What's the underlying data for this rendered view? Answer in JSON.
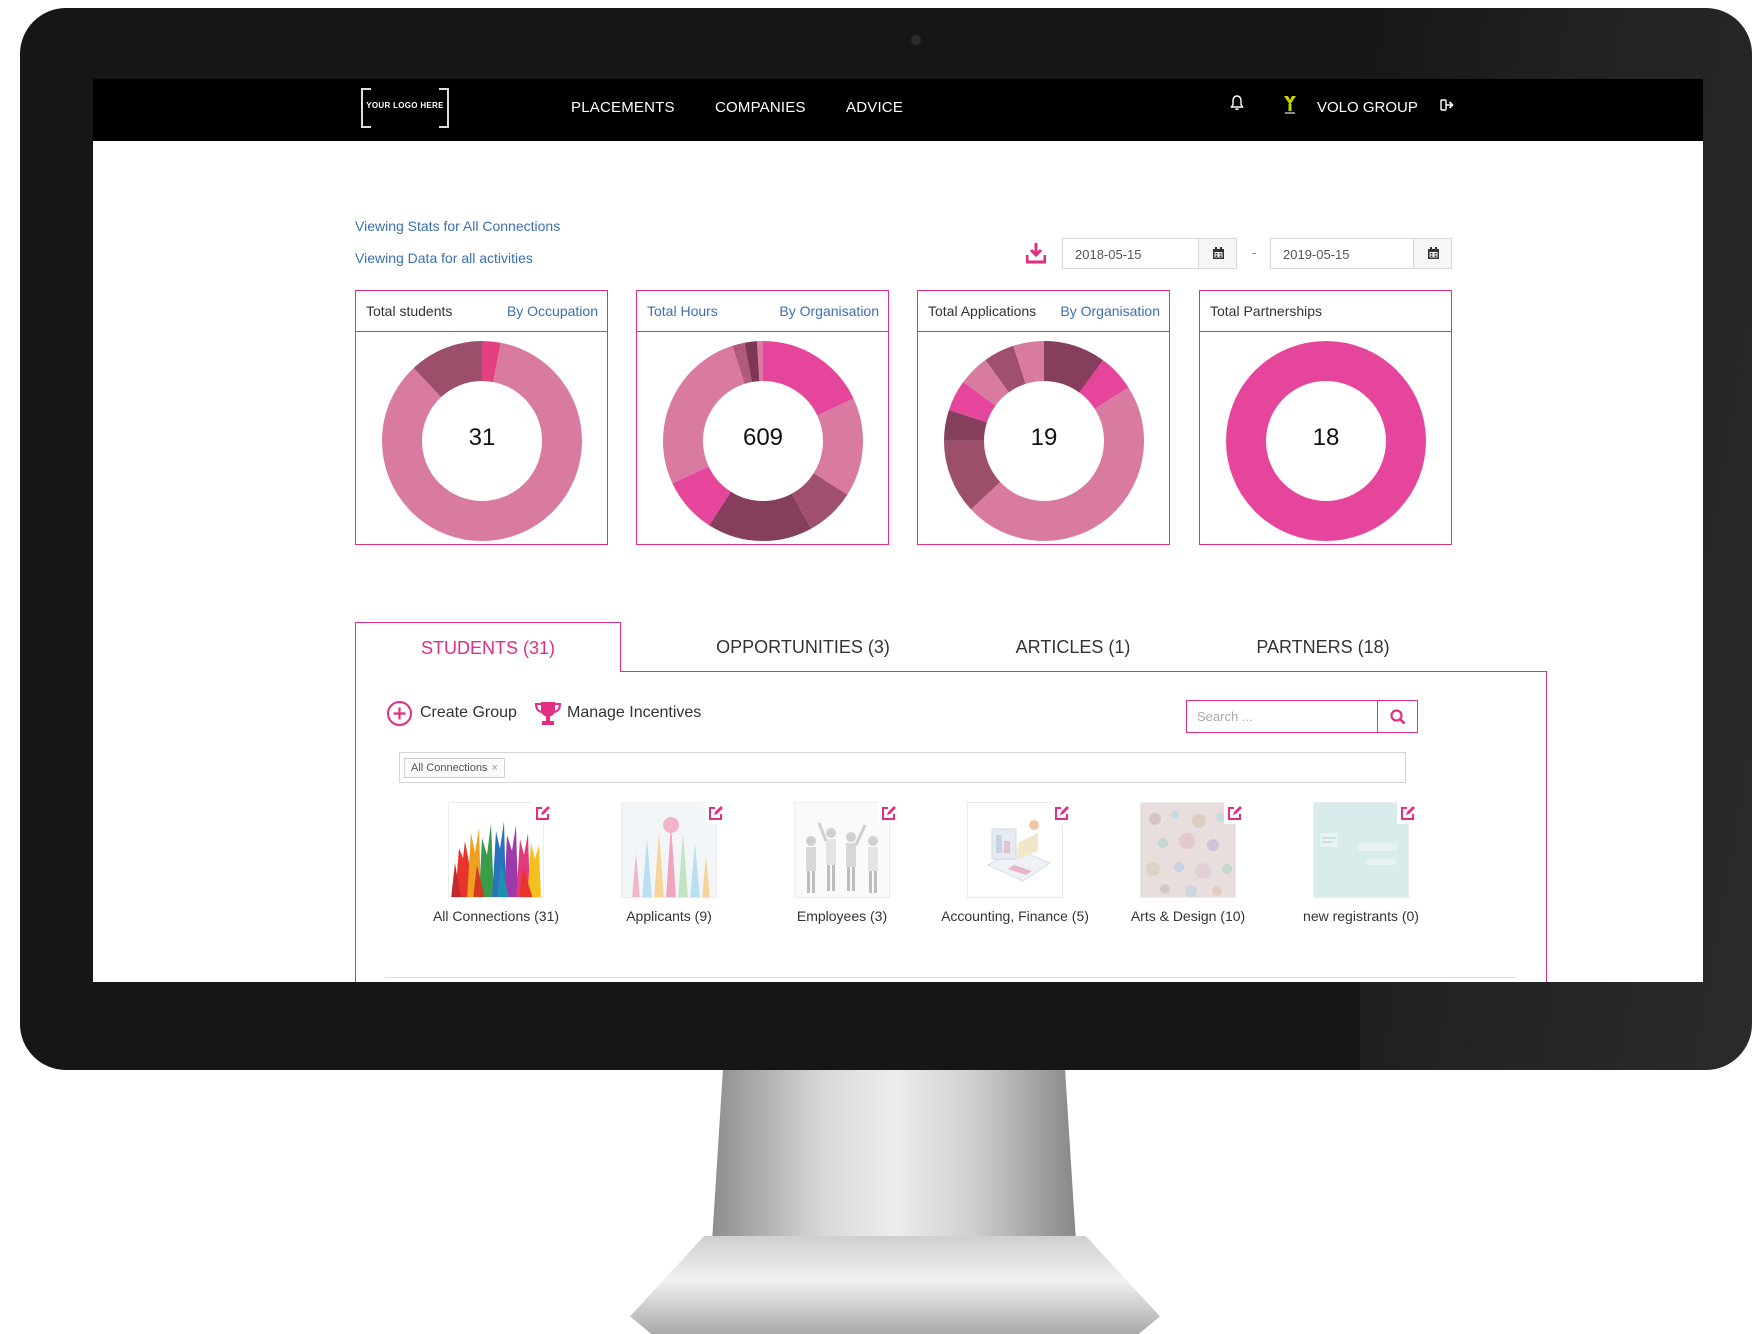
{
  "nav": {
    "logo_text": "YOUR LOGO HERE",
    "links": [
      {
        "label": "PLACEMENTS"
      },
      {
        "label": "COMPANIES"
      },
      {
        "label": "ADVICE"
      }
    ],
    "user_name": "VOLO GROUP",
    "icons": [
      "bell-icon",
      "volo-logo-icon",
      "logout-icon"
    ]
  },
  "header": {
    "viewing_stats": "Viewing Stats for All Connections",
    "viewing_data": "Viewing Data for all activities",
    "date_from": "2018-05-15",
    "date_to": "2019-05-15",
    "date_separator": "-"
  },
  "cards": [
    {
      "title": "Total students",
      "link": "By Occupation",
      "value": "31",
      "segments": [
        {
          "frac": 0.03,
          "color": "#e3407f"
        },
        {
          "frac": 0.85,
          "color": "#d97aa0"
        },
        {
          "frac": 0.12,
          "color": "#9c4f6b"
        }
      ]
    },
    {
      "title": "Total Hours",
      "link": "By Organisation",
      "value": "609",
      "segments": [
        {
          "frac": 0.18,
          "color": "#e6459c"
        },
        {
          "frac": 0.16,
          "color": "#d97aa0"
        },
        {
          "frac": 0.08,
          "color": "#a14f6f"
        },
        {
          "frac": 0.17,
          "color": "#853f5d"
        },
        {
          "frac": 0.09,
          "color": "#e6459c"
        },
        {
          "frac": 0.27,
          "color": "#d97aa0"
        },
        {
          "frac": 0.02,
          "color": "#b25a7c"
        },
        {
          "frac": 0.02,
          "color": "#7e3656"
        },
        {
          "frac": 0.01,
          "color": "#d97aa0"
        }
      ]
    },
    {
      "title": "Total Applications",
      "link": "By Organisation",
      "value": "19",
      "segments": [
        {
          "frac": 0.16,
          "color": "#e6459c"
        },
        {
          "frac": 0.47,
          "color": "#d97aa0"
        },
        {
          "frac": 0.12,
          "color": "#9c4f6b"
        },
        {
          "frac": 0.05,
          "color": "#853f5d"
        },
        {
          "frac": 0.05,
          "color": "#e6459c"
        },
        {
          "frac": 0.05,
          "color": "#d97aa0"
        },
        {
          "frac": 0.05,
          "color": "#a14f6f"
        },
        {
          "frac": 0.05,
          "color": "#d97aa0"
        },
        {
          "frac": 0.1,
          "color": "#853f5d"
        }
      ]
    },
    {
      "title": "Total Partnerships",
      "link": "",
      "value": "18",
      "segments": [
        {
          "frac": 1.0,
          "color": "#e6459c"
        }
      ]
    }
  ],
  "tabs": [
    {
      "label": "STUDENTS (31)",
      "active": true
    },
    {
      "label": "OPPORTUNITIES (3)",
      "active": false
    },
    {
      "label": "ARTICLES (1)",
      "active": false
    },
    {
      "label": "PARTNERS (18)",
      "active": false
    }
  ],
  "actions": {
    "create_group": "Create Group",
    "manage_incentives": "Manage Incentives"
  },
  "search": {
    "placeholder": "Search ..."
  },
  "filter": {
    "chip": "All Connections",
    "chip_remove": "×"
  },
  "groups": [
    {
      "label": "All Connections (31)"
    },
    {
      "label": "Applicants (9)"
    },
    {
      "label": "Employees (3)"
    },
    {
      "label": "Accounting, Finance (5)"
    },
    {
      "label": "Arts & Design (10)"
    },
    {
      "label": "new registrants (0)"
    }
  ],
  "colors": {
    "accent": "#e32c84",
    "link": "#3b6fb3",
    "nav_bg": "#000000"
  }
}
